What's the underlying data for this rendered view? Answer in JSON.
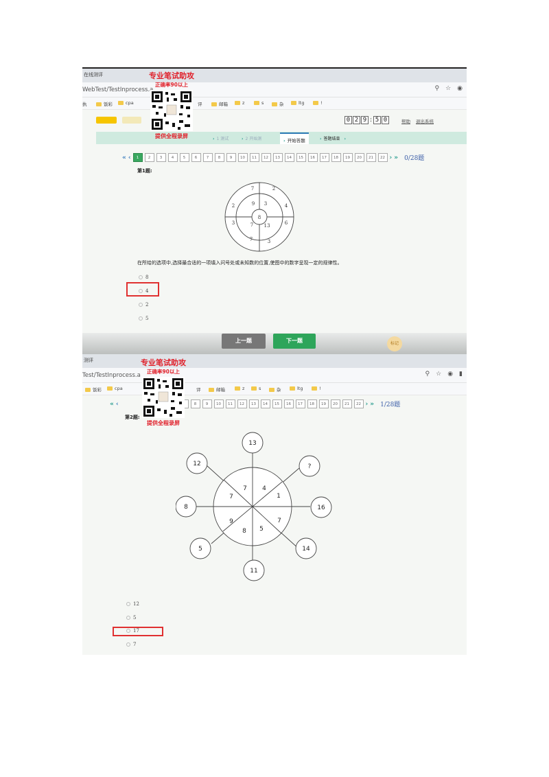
{
  "watermark": {
    "line1": "专业笔试助攻",
    "line2": "正确率90以上",
    "line3": "提供全程录屏"
  },
  "shot1": {
    "tab_title": "在线测评",
    "url": "WebTest/TestInprocess.a",
    "bookmarks": [
      "执",
      "饭彩",
      "cpa",
      "评",
      "邮箱",
      "z",
      "s",
      "杂",
      "ltg",
      "!"
    ],
    "logos": [
      "",
      ""
    ],
    "timer_digits": [
      "0",
      "2",
      "9",
      "5",
      "0"
    ],
    "timer_sep": ":",
    "header_links": [
      "帮助",
      "退出系统"
    ],
    "steps": [
      "1 测试",
      "2 开始测",
      "开始答题",
      "答题结束"
    ],
    "pager": {
      "cells": [
        "1",
        "2",
        "3",
        "4",
        "5",
        "6",
        "7",
        "8",
        "9",
        "10",
        "11",
        "12",
        "13",
        "14",
        "15",
        "16",
        "17",
        "18",
        "19",
        "20",
        "21",
        "22"
      ],
      "current": "1",
      "count": "0/28题"
    },
    "question_label": "第1题:",
    "figure": {
      "outer_top": [
        "7",
        "2"
      ],
      "middle": [
        "2",
        "9",
        "3",
        "4"
      ],
      "center": "8",
      "lower": [
        "3",
        "7",
        "13",
        "6"
      ],
      "outer_bottom": [
        "7",
        "3"
      ]
    },
    "instruction": "在所给的选项中,选择最合适的一项填入问号处或未知数的位置,使图中的数字呈现一定的规律性。",
    "options": [
      "8",
      "4",
      "2",
      "5"
    ],
    "buttons": {
      "prev": "上一题",
      "next": "下一题",
      "mark": "标记"
    }
  },
  "shot2": {
    "tab_title": "测评",
    "url": "Test/TestInprocess.a",
    "bookmarks": [
      "饭彩",
      "cpa",
      "评",
      "邮箱",
      "z",
      "s",
      "杂",
      "ltg",
      "!"
    ],
    "pager": {
      "cells": [
        "6",
        "7",
        "8",
        "9",
        "10",
        "11",
        "12",
        "13",
        "14",
        "15",
        "16",
        "17",
        "18",
        "19",
        "20",
        "21",
        "22"
      ],
      "count": "1/28题"
    },
    "question_label": "第2题:",
    "figure": {
      "satellites": [
        "13",
        "?",
        "16",
        "14",
        "11",
        "5",
        "8",
        "12"
      ],
      "inner": [
        "7",
        "4",
        "1",
        "7",
        "5",
        "8",
        "9",
        "7"
      ]
    },
    "options": [
      "12",
      "5",
      "17",
      "7"
    ]
  }
}
